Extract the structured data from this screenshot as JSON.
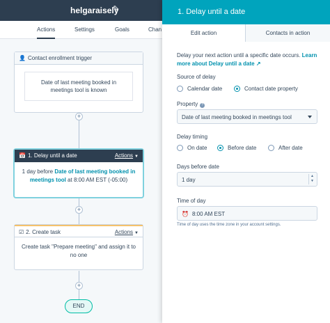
{
  "workflow": {
    "name": "helgaraisely",
    "tabs": [
      {
        "label": "Actions",
        "active": true
      },
      {
        "label": "Settings",
        "active": false
      },
      {
        "label": "Goals",
        "active": false
      },
      {
        "label": "Chan",
        "active": false
      }
    ]
  },
  "trigger": {
    "title": "Contact enrollment trigger",
    "criteria": "Date of last meeting booked in meetings tool",
    "criteria_suffix": " is known"
  },
  "delay_step": {
    "title": "1. Delay until a date",
    "actions_label": "Actions",
    "body_prefix": "1 day before ",
    "body_property": "Date of last meeting booked in meetings tool",
    "body_suffix": " at 8:00 AM EST (-05:00)"
  },
  "task_step": {
    "title": "2. Create task",
    "actions_label": "Actions",
    "body": "Create task \"Prepare meeting\" and assign it to no one"
  },
  "end_label": "END",
  "panel": {
    "title": "1. Delay until a date",
    "tabs": [
      {
        "label": "Edit action",
        "active": true
      },
      {
        "label": "Contacts in action",
        "active": false
      }
    ],
    "description": "Delay your next action until a specific date occurs.",
    "learn_more": "Learn more about Delay until a date",
    "source_label": "Source of delay",
    "source_options": [
      {
        "label": "Calendar date",
        "selected": false
      },
      {
        "label": "Contact date property",
        "selected": true
      }
    ],
    "property_label": "Property",
    "property_value": "Date of last meeting booked in meetings tool",
    "timing_label": "Delay timing",
    "timing_options": [
      {
        "label": "On date",
        "selected": false
      },
      {
        "label": "Before date",
        "selected": true
      },
      {
        "label": "After date",
        "selected": false
      }
    ],
    "days_label": "Days before date",
    "days_value": "1 day",
    "time_label": "Time of day",
    "time_value": "8:00 AM EST",
    "time_hint": "Time of day uses the time zone in your account settings."
  },
  "colors": {
    "header_teal": "#00a4bd",
    "link": "#0091ae",
    "dark_nav": "#2d3e50"
  }
}
